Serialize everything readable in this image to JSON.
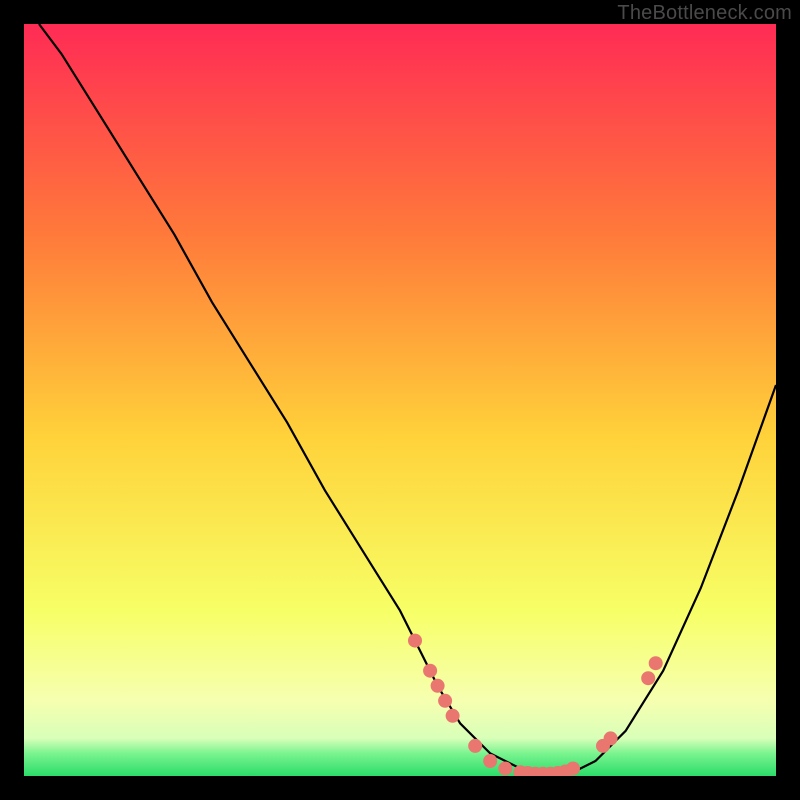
{
  "attribution": "TheBottleneck.com",
  "colors": {
    "gradient_top": "#ff2b55",
    "gradient_mid_upper": "#ff7a3a",
    "gradient_mid": "#ffd23a",
    "gradient_lower": "#f7ff66",
    "gradient_pale": "#f6ffb0",
    "gradient_green": "#2bdc6a",
    "curve": "#000000",
    "dot": "#e9766f"
  },
  "chart_data": {
    "type": "line",
    "title": "",
    "xlabel": "",
    "ylabel": "",
    "xlim": [
      0,
      100
    ],
    "ylim": [
      0,
      100
    ],
    "series": [
      {
        "name": "bottleneck-curve",
        "x": [
          2,
          5,
          10,
          15,
          20,
          25,
          30,
          35,
          40,
          45,
          50,
          52,
          55,
          58,
          62,
          66,
          70,
          72,
          76,
          80,
          85,
          90,
          95,
          100
        ],
        "y": [
          100,
          96,
          88,
          80,
          72,
          63,
          55,
          47,
          38,
          30,
          22,
          18,
          12,
          7,
          3,
          1,
          0,
          0,
          2,
          6,
          14,
          25,
          38,
          52
        ]
      }
    ],
    "points": [
      {
        "x": 52,
        "y": 18
      },
      {
        "x": 54,
        "y": 14
      },
      {
        "x": 55,
        "y": 12
      },
      {
        "x": 56,
        "y": 10
      },
      {
        "x": 57,
        "y": 8
      },
      {
        "x": 60,
        "y": 4
      },
      {
        "x": 62,
        "y": 2
      },
      {
        "x": 64,
        "y": 1
      },
      {
        "x": 66,
        "y": 0.5
      },
      {
        "x": 67,
        "y": 0.4
      },
      {
        "x": 68,
        "y": 0.3
      },
      {
        "x": 69,
        "y": 0.3
      },
      {
        "x": 70,
        "y": 0.3
      },
      {
        "x": 71,
        "y": 0.4
      },
      {
        "x": 72,
        "y": 0.6
      },
      {
        "x": 73,
        "y": 1
      },
      {
        "x": 77,
        "y": 4
      },
      {
        "x": 78,
        "y": 5
      },
      {
        "x": 83,
        "y": 13
      },
      {
        "x": 84,
        "y": 15
      }
    ],
    "green_band_y_range": [
      0,
      4
    ],
    "pale_band_y_range": [
      4,
      16
    ]
  }
}
